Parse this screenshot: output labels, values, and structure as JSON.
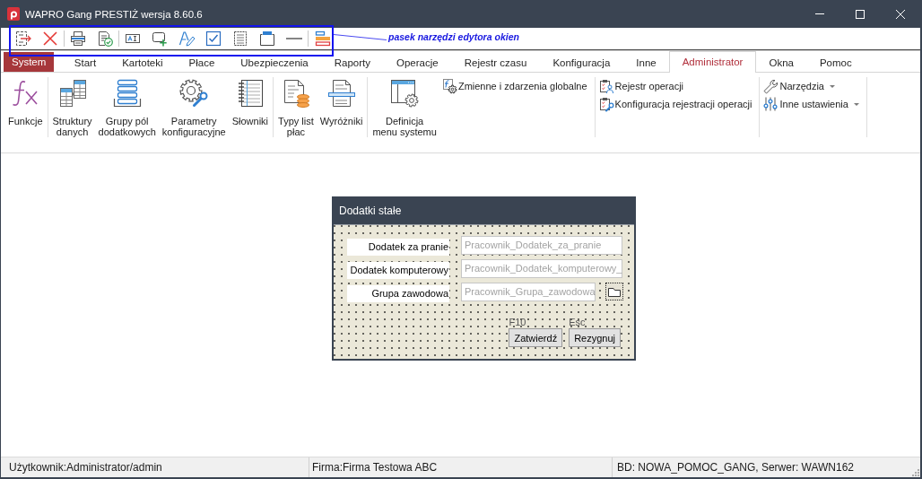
{
  "window": {
    "title": "WAPRO Gang PRESTIŻ wersja 8.60.6"
  },
  "annotation": {
    "text": "pasek narzędzi edytora okien"
  },
  "menu_tabs": [
    {
      "label": "System",
      "kind": "app",
      "selected": false
    },
    {
      "label": "Start",
      "kind": "tab",
      "selected": false
    },
    {
      "label": "Kartoteki",
      "kind": "tab",
      "selected": false
    },
    {
      "label": "Płace",
      "kind": "tab",
      "selected": false
    },
    {
      "label": "Ubezpieczenia",
      "kind": "tab",
      "selected": false
    },
    {
      "label": "Raporty",
      "kind": "tab",
      "selected": false
    },
    {
      "label": "Operacje",
      "kind": "tab",
      "selected": false
    },
    {
      "label": "Rejestr czasu",
      "kind": "tab",
      "selected": false
    },
    {
      "label": "Konfiguracja",
      "kind": "tab",
      "selected": false
    },
    {
      "label": "Inne",
      "kind": "tab",
      "selected": false
    },
    {
      "label": "Administrator",
      "kind": "tab",
      "selected": true
    },
    {
      "label": "Okna",
      "kind": "tab",
      "selected": false
    },
    {
      "label": "Pomoc",
      "kind": "tab",
      "selected": false
    }
  ],
  "ribbon": {
    "groups": [
      {
        "large_buttons": [
          {
            "label": "Funkcje"
          }
        ]
      },
      {
        "large_buttons": [
          {
            "label": "Struktury\ndanych"
          },
          {
            "label": "Grupy pól\ndodatkowych"
          },
          {
            "label": "Parametry\nkonfiguracyjne"
          },
          {
            "label": "Słowniki"
          }
        ]
      },
      {
        "large_buttons": [
          {
            "label": "Typy list\npłac"
          },
          {
            "label": "Wyróżniki"
          }
        ]
      },
      {
        "large_buttons": [
          {
            "label": "Definicja\nmenu systemu"
          }
        ],
        "small_buttons": [
          {
            "label": "Zmienne i zdarzenia globalne",
            "dropdown": false
          }
        ]
      },
      {
        "small_buttons": [
          {
            "label": "Rejestr operacji",
            "dropdown": false
          },
          {
            "label": "Konfiguracja rejestracji operacji",
            "dropdown": false
          }
        ]
      },
      {
        "small_buttons": [
          {
            "label": "Narzędzia",
            "dropdown": true
          },
          {
            "label": "Inne ustawienia",
            "dropdown": true
          }
        ]
      }
    ]
  },
  "dialog": {
    "title": "Dodatki stałe",
    "fields": [
      {
        "label": "Dodatek za pranie",
        "value": "Pracownik_Dodatek_za_pranie",
        "disabled": true,
        "browse_button": false
      },
      {
        "label": "Dodatek komputerowy",
        "value": "Pracownik_Dodatek_komputerowy_",
        "disabled": true,
        "browse_button": false
      },
      {
        "label": "Grupa zawodowa",
        "value": "Pracownik_Grupa_zawodowa",
        "disabled": true,
        "browse_button": true
      }
    ],
    "buttons": [
      {
        "label": "Zatwierdź",
        "shortcut": "F10"
      },
      {
        "label": "Rezygnuj",
        "shortcut": "Esc"
      }
    ]
  },
  "status_bar": [
    {
      "text": "Użytkownik:Administrator/admin"
    },
    {
      "text": "Firma:Firma Testowa ABC"
    },
    {
      "text": "BD: NOWA_POMOC_GANG, Serwer: WAWN162"
    }
  ]
}
